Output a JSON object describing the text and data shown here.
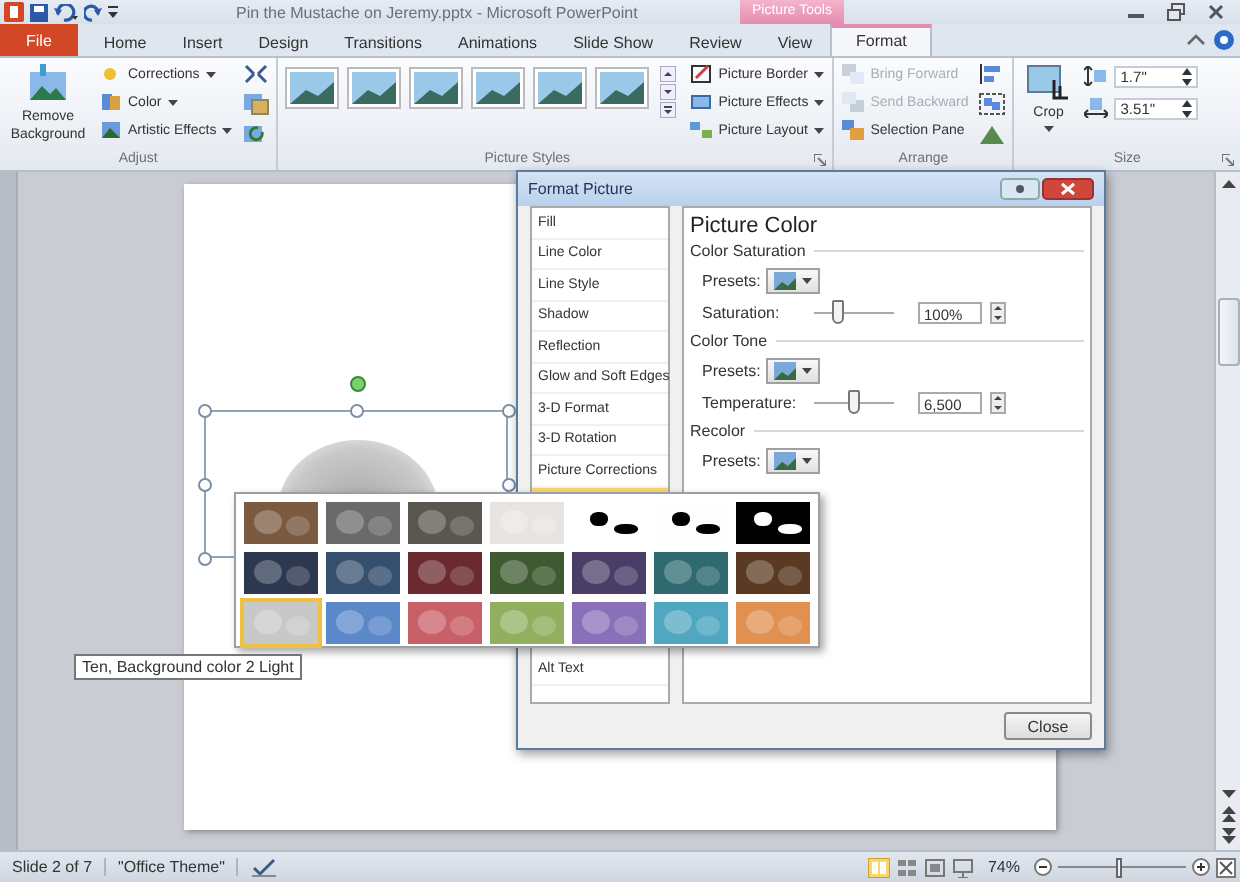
{
  "window": {
    "title": "Pin the Mustache on Jeremy.pptx - Microsoft PowerPoint",
    "contextual_tab_group": "Picture Tools"
  },
  "tabs": [
    {
      "label": "File",
      "kind": "file",
      "selected": false
    },
    {
      "label": "Home",
      "kind": "plain",
      "selected": false
    },
    {
      "label": "Insert",
      "kind": "plain",
      "selected": false
    },
    {
      "label": "Design",
      "kind": "plain",
      "selected": false
    },
    {
      "label": "Transitions",
      "kind": "plain",
      "selected": false
    },
    {
      "label": "Animations",
      "kind": "plain",
      "selected": false
    },
    {
      "label": "Slide Show",
      "kind": "plain",
      "selected": false
    },
    {
      "label": "Review",
      "kind": "plain",
      "selected": false
    },
    {
      "label": "View",
      "kind": "plain",
      "selected": false
    },
    {
      "label": "Format",
      "kind": "contextual",
      "selected": true
    }
  ],
  "ribbon": {
    "groups": [
      {
        "kind": "adjust",
        "label": "Adjust",
        "big_button": "Remove Background",
        "buttons": [
          {
            "label": "Corrections",
            "disabled": false
          },
          {
            "label": "Color",
            "disabled": false
          },
          {
            "label": "Artistic Effects",
            "disabled": false
          }
        ]
      },
      {
        "kind": "styles",
        "label": "Picture Styles",
        "launcher": true,
        "buttons": [
          {
            "label": "Picture Border",
            "disabled": false
          },
          {
            "label": "Picture Effects",
            "disabled": false
          },
          {
            "label": "Picture Layout",
            "disabled": false
          }
        ]
      },
      {
        "kind": "arrange",
        "label": "Arrange",
        "buttons": [
          {
            "label": "Bring Forward",
            "disabled": true
          },
          {
            "label": "Send Backward",
            "disabled": true
          },
          {
            "label": "Selection Pane",
            "disabled": false
          }
        ]
      },
      {
        "kind": "size",
        "label": "Size",
        "launcher": true,
        "big_button": "Crop",
        "fields": [
          {
            "value": "1.7\""
          },
          {
            "value": "3.51\""
          }
        ]
      }
    ]
  },
  "dialog": {
    "title": "Format Picture",
    "categories": [
      {
        "label": "Fill",
        "selected": false
      },
      {
        "label": "Line Color",
        "selected": false
      },
      {
        "label": "Line Style",
        "selected": false
      },
      {
        "label": "Shadow",
        "selected": false
      },
      {
        "label": "Reflection",
        "selected": false
      },
      {
        "label": "Glow and Soft Edges",
        "selected": false
      },
      {
        "label": "3-D Format",
        "selected": false
      },
      {
        "label": "3-D Rotation",
        "selected": false
      },
      {
        "label": "Picture Corrections",
        "selected": false
      },
      {
        "selected": true
      },
      {
        "label": "Alt Text",
        "selected": false
      }
    ],
    "panel": {
      "heading": "Picture Color",
      "sections": [
        {
          "title": "Color Saturation",
          "presets_label": "Presets:",
          "slider": {
            "label": "Saturation:",
            "level": 0.3,
            "value": "100%"
          }
        },
        {
          "title": "Color Tone",
          "presets_label": "Presets:",
          "slider": {
            "label": "Temperature:",
            "level": 0.5,
            "value": "6,500"
          }
        },
        {
          "title": "Recolor",
          "presets_label": "Presets:"
        }
      ]
    },
    "close_button": "Close"
  },
  "gallery": {
    "swatches": [
      {
        "kind": "photo",
        "color": "#7a5a40",
        "selected": false
      },
      {
        "kind": "photo",
        "color": "#6a6a6a",
        "selected": false
      },
      {
        "kind": "photo",
        "color": "#5a5650",
        "selected": false
      },
      {
        "kind": "photo",
        "color": "#e8e4e2",
        "selected": false
      },
      {
        "kind": "threshold",
        "color": "#ffffff",
        "selected": false
      },
      {
        "kind": "threshold",
        "color": "#fefefe",
        "selected": false
      },
      {
        "kind": "threshold",
        "color": "#000000",
        "selected": false
      },
      {
        "kind": "photo",
        "color": "#2c3850",
        "selected": false
      },
      {
        "kind": "photo",
        "color": "#35506e",
        "selected": false
      },
      {
        "kind": "photo",
        "color": "#6a2a30",
        "selected": false
      },
      {
        "kind": "photo",
        "color": "#3e5a30",
        "selected": false
      },
      {
        "kind": "photo",
        "color": "#4a3e68",
        "selected": false
      },
      {
        "kind": "photo",
        "color": "#2e6a70",
        "selected": false
      },
      {
        "kind": "photo",
        "color": "#5a3a22",
        "selected": false
      },
      {
        "kind": "photo",
        "color": "#c8c8c8",
        "selected": true
      },
      {
        "kind": "photo",
        "color": "#5a88c8",
        "selected": false
      },
      {
        "kind": "photo",
        "color": "#c86068",
        "selected": false
      },
      {
        "kind": "photo",
        "color": "#90b060",
        "selected": false
      },
      {
        "kind": "photo",
        "color": "#8a70b8",
        "selected": false
      },
      {
        "kind": "photo",
        "color": "#50a8c0",
        "selected": false
      },
      {
        "kind": "photo",
        "color": "#e09050",
        "selected": false
      }
    ],
    "tooltip": "Ten, Background color 2 Light"
  },
  "status_bar": {
    "slide_info": "Slide 2 of 7",
    "theme": "\"Office Theme\"",
    "zoom": "74%",
    "zoom_slider": {
      "level": 0.48
    }
  }
}
